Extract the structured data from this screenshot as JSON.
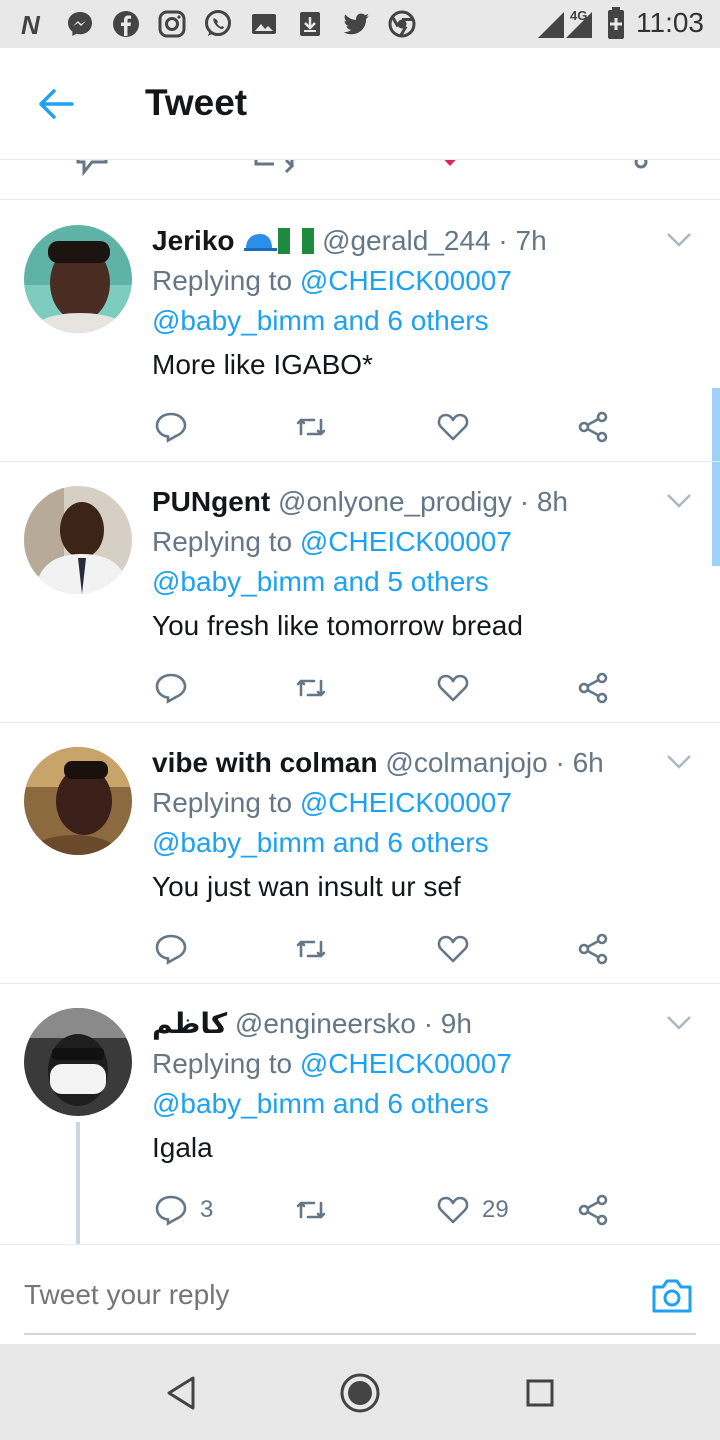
{
  "status_bar": {
    "time": "11:03",
    "network": "4G",
    "icons": [
      "n-app-icon",
      "messenger-icon",
      "facebook-icon",
      "instagram-icon",
      "whatsapp-icon",
      "gallery-icon",
      "download-icon",
      "twitter-icon",
      "chrome-icon",
      "signal-icon",
      "battery-icon"
    ]
  },
  "header": {
    "title": "Tweet",
    "back_icon": "back-arrow-icon"
  },
  "tweets": [
    {
      "name": "Jeriko",
      "name_emoji_desc": "cap and Nigeria flag",
      "handle": "@gerald_244",
      "time": "7h",
      "replying_prefix": "Replying to",
      "replying_to": "@CHEICK00007",
      "replying_rest": "@baby_bimm and 6 others",
      "text": "More like IGABO*",
      "reply_count": "",
      "like_count": ""
    },
    {
      "name": "PUNgent",
      "handle": "@onlyone_prodigy",
      "time": "8h",
      "replying_prefix": "Replying to",
      "replying_to": "@CHEICK00007",
      "replying_rest": "@baby_bimm and 5 others",
      "text": "You fresh like tomorrow bread",
      "reply_count": "",
      "like_count": ""
    },
    {
      "name": "vibe with colman",
      "handle": "@colmanjojo",
      "time": "6h",
      "replying_prefix": "Replying to",
      "replying_to": "@CHEICK00007",
      "replying_rest": "@baby_bimm and 6 others",
      "text": "You just wan insult ur sef",
      "reply_count": "",
      "like_count": ""
    },
    {
      "name": "كاظم",
      "handle": "@engineersko",
      "time": "9h",
      "replying_prefix": "Replying to",
      "replying_to": "@CHEICK00007",
      "replying_rest": "@baby_bimm and 6 others",
      "text": "Igala",
      "reply_count": "3",
      "like_count": "29"
    }
  ],
  "reply_bar": {
    "placeholder": "Tweet your reply"
  },
  "colors": {
    "accent": "#1da1f2",
    "secondary_text": "#657786",
    "primary_text": "#14171a",
    "like_red": "#e0245e"
  }
}
